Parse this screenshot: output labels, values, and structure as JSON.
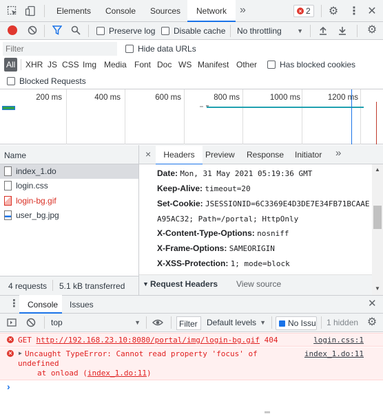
{
  "toolbar": {
    "tabs": [
      "Elements",
      "Console",
      "Sources",
      "Network"
    ],
    "active_tab": "Network",
    "more": "»",
    "error_count": "2"
  },
  "network_toolbar": {
    "preserve_log": "Preserve log",
    "disable_cache": "Disable cache",
    "throttling": "No throttling"
  },
  "filter_bar": {
    "placeholder": "Filter",
    "hide_data_urls": "Hide data URLs"
  },
  "filter_types": {
    "all": "All",
    "types": [
      "XHR",
      "JS",
      "CSS",
      "Img",
      "Media",
      "Font",
      "Doc",
      "WS",
      "Manifest",
      "Other"
    ],
    "has_blocked_cookies": "Has blocked cookies",
    "blocked_requests": "Blocked Requests"
  },
  "timeline": {
    "ticks": [
      "200 ms",
      "400 ms",
      "600 ms",
      "800 ms",
      "1000 ms",
      "1200 ms"
    ]
  },
  "request_list": {
    "header": "Name",
    "items": [
      {
        "name": "index_1.do",
        "color": "#303942"
      },
      {
        "name": "login.css",
        "color": "#303942"
      },
      {
        "name": "login-bg.gif",
        "color": "#d93025"
      },
      {
        "name": "user_bg.jpg",
        "color": "#303942"
      }
    ],
    "summary_requests": "4 requests",
    "summary_transferred": "5.1 kB transferred"
  },
  "details": {
    "close": "×",
    "tabs": [
      "Headers",
      "Preview",
      "Response",
      "Initiator"
    ],
    "more": "»",
    "headers": [
      {
        "name": "Date:",
        "value": "Mon, 31 May 2021 05:19:36 GMT"
      },
      {
        "name": "Keep-Alive:",
        "value": "timeout=20"
      },
      {
        "name": "Set-Cookie:",
        "value": "JSESSIONID=6C3369E4D3DE7E34FB71BCAAE"
      },
      {
        "name": "",
        "value": "A95AC32; Path=/portal; HttpOnly"
      },
      {
        "name": "X-Content-Type-Options:",
        "value": "nosniff"
      },
      {
        "name": "X-Frame-Options:",
        "value": "SAMEORIGIN"
      },
      {
        "name": "X-XSS-Protection:",
        "value": "1; mode=block"
      }
    ],
    "request_headers": "Request Headers",
    "view_source": "View source"
  },
  "drawer": {
    "tabs": [
      "Console",
      "Issues"
    ],
    "context": "top",
    "filter_label": "Filter",
    "levels": "Default levels",
    "issues_badge": "No Issu",
    "hidden": "1 hidden"
  },
  "console": {
    "error1": {
      "method": "GET",
      "url": "http://192.168.23.10:8080/portal/img/login-bg.gif",
      "status": "404",
      "source": "login.css:1"
    },
    "error2": {
      "line1": "Uncaught TypeError: Cannot read property 'focus' of",
      "line2": "undefined",
      "line3_prefix": "at onload (",
      "line3_link": "index_1.do:11",
      "line3_suffix": ")",
      "source": "index_1.do:11"
    },
    "prompt": "›"
  },
  "colors": {
    "accent": "#1a73e8",
    "error": "#e01f1f",
    "error_bg": "#fff0f0",
    "toolbar_bg": "#f1f3f4"
  }
}
